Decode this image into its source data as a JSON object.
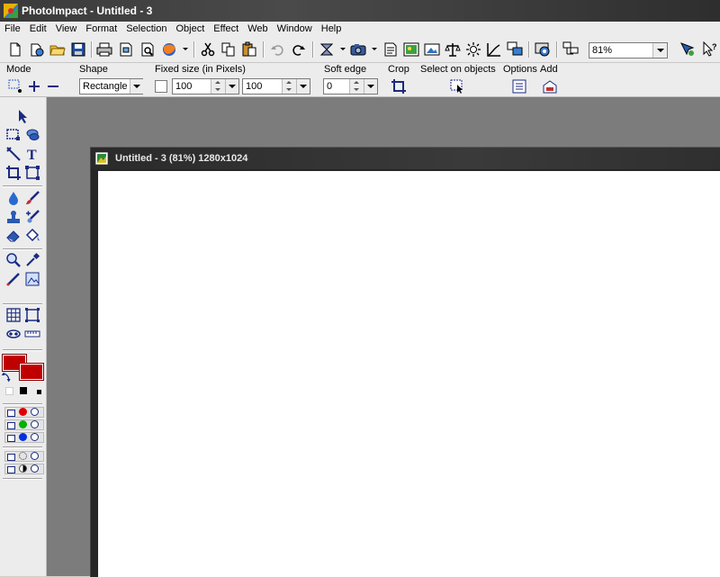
{
  "app": {
    "title": "PhotoImpact - Untitled - 3"
  },
  "menu": [
    "File",
    "Edit",
    "View",
    "Format",
    "Selection",
    "Object",
    "Effect",
    "Web",
    "Window",
    "Help"
  ],
  "toolbar": {
    "zoom_value": "81%",
    "buttons": [
      "new-icon",
      "open-from-web-icon",
      "open-folder-icon",
      "save-icon",
      "print-icon",
      "print-preview-icon",
      "scan-icon",
      "browser-icon",
      "cut-icon",
      "copy-icon",
      "paste-icon",
      "undo-icon",
      "redo-icon",
      "path-icon",
      "camera-icon",
      "document-icon",
      "image-optimizer-icon",
      "picture-icon",
      "tone-icon",
      "brightness-icon",
      "graph-icon",
      "layout-icon",
      "screen-icon",
      "web-icon",
      "easypalette-icon",
      "help-pointer-icon"
    ]
  },
  "attributes": {
    "mode_label": "Mode",
    "shape_label": "Shape",
    "shape_value": "Rectangle",
    "fixed_size_label": "Fixed size (in Pixels)",
    "width_value": "100",
    "height_value": "100",
    "soft_edge_label": "Soft edge",
    "soft_edge_value": "0",
    "crop_label": "Crop",
    "select_on_objects_label": "Select on objects",
    "options_label": "Options",
    "add_label": "Add"
  },
  "colors": {
    "foreground": "#c00000",
    "background": "#c00000",
    "workspace": "#7c7c7c"
  },
  "document": {
    "title": "Untitled - 3 (81%) 1280x1024"
  }
}
